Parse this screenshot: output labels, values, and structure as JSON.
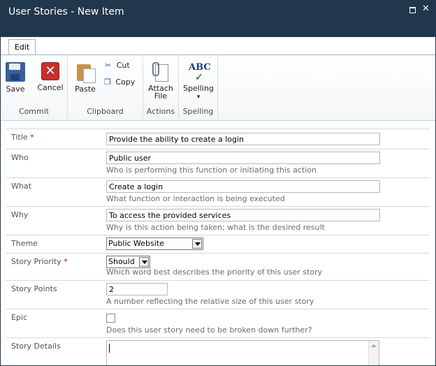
{
  "window": {
    "title": "User Stories - New Item",
    "maximize_icon": "maximize-icon",
    "close_icon": "close-icon"
  },
  "ribbon": {
    "tabs": [
      {
        "label": "Edit",
        "selected": true
      }
    ],
    "groups": [
      {
        "label": "Commit",
        "buttons": [
          {
            "label": "Save",
            "icon": "save-icon"
          },
          {
            "label": "Cancel",
            "icon": "cancel-icon"
          }
        ]
      },
      {
        "label": "Clipboard",
        "buttons": [
          {
            "label": "Paste",
            "icon": "paste-icon"
          },
          {
            "label": "Cut",
            "icon": "scissors-icon"
          },
          {
            "label": "Copy",
            "icon": "copy-icon"
          }
        ]
      },
      {
        "label": "Actions",
        "buttons": [
          {
            "label": "Attach",
            "label2": "File",
            "icon": "paperclip-icon"
          }
        ]
      },
      {
        "label": "Spelling",
        "buttons": [
          {
            "label": "Spelling",
            "icon": "spellcheck-icon",
            "glyph": "ABC",
            "dropdown": "▾"
          }
        ]
      }
    ]
  },
  "form": {
    "fields": [
      {
        "label": "Title",
        "required_mark": "*",
        "value": "Provide the ability to create a login",
        "description": ""
      },
      {
        "label": "Who",
        "value": "Public user",
        "description": "Who is performing this function or initiating this action"
      },
      {
        "label": "What",
        "value": "Create a login",
        "description": "What function or interaction is being executed"
      },
      {
        "label": "Why",
        "value": "To access the provided services",
        "description": "Why is this action being taken; what is the desired result"
      },
      {
        "label": "Theme",
        "value": "Public Website",
        "description": ""
      },
      {
        "label": "Story Priority",
        "required_mark": "*",
        "value": "Should",
        "description": "Which word best describes the priority of this user story"
      },
      {
        "label": "Story Points",
        "value": "2",
        "description": "A number reflecting the relative size of this user story"
      },
      {
        "label": "Epic",
        "checked": false,
        "description": "Does this user story need to be broken down further?"
      },
      {
        "label": "Story Details",
        "value": "",
        "description": ""
      }
    ]
  },
  "colors": {
    "titlebar": "#21374c",
    "required": "#bf0000"
  }
}
